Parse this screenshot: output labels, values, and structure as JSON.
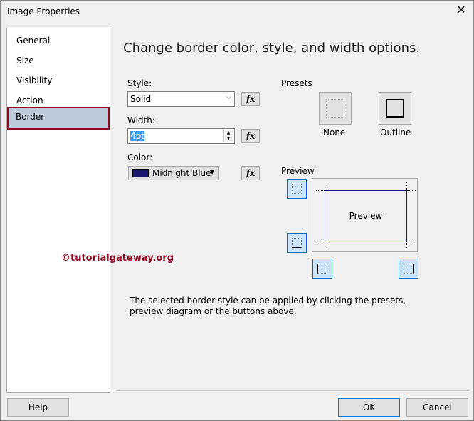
{
  "window": {
    "title": "Image Properties",
    "close": "✕"
  },
  "nav": {
    "items": [
      {
        "label": "General"
      },
      {
        "label": "Size"
      },
      {
        "label": "Visibility"
      },
      {
        "label": "Action"
      },
      {
        "label": "Border"
      }
    ]
  },
  "main": {
    "heading": "Change border color, style, and width options.",
    "style": {
      "label": "Style:",
      "value": "Solid"
    },
    "width": {
      "label": "Width:",
      "value": "4pt"
    },
    "color": {
      "label": "Color:",
      "value": "Midnight Blue",
      "swatch": "#191970"
    },
    "fx": "fx",
    "presets": {
      "label": "Presets",
      "none": "None",
      "outline": "Outline"
    },
    "preview": {
      "label": "Preview",
      "text": "Preview"
    },
    "hint": "The selected border style can be applied by clicking the presets, preview diagram or the buttons above.",
    "watermark": "©tutorialgateway.org"
  },
  "footer": {
    "help": "Help",
    "ok": "OK",
    "cancel": "Cancel"
  }
}
